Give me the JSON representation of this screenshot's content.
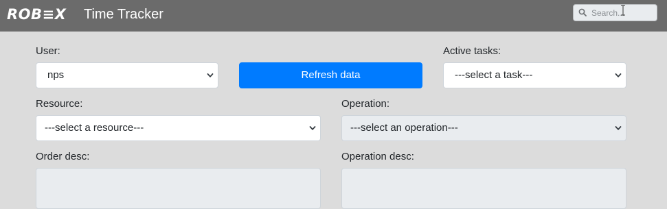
{
  "header": {
    "logo_text": "ROB≡X",
    "title": "Time Tracker",
    "search": {
      "placeholder": "Search..."
    }
  },
  "form": {
    "user": {
      "label": "User:",
      "value": "nps"
    },
    "refresh_button": {
      "label": "Refresh data"
    },
    "active_tasks": {
      "label": "Active tasks:",
      "value": "---select a task---"
    },
    "resource": {
      "label": "Resource:",
      "value": "---select a resource---"
    },
    "operation": {
      "label": "Operation:",
      "value": "---select an operation---"
    },
    "order_desc": {
      "label": "Order desc:",
      "value": ""
    },
    "operation_desc": {
      "label": "Operation desc:",
      "value": ""
    }
  },
  "colors": {
    "navbar": "#6b6b6b",
    "background": "#dcdcdc",
    "primary_button": "#007bff",
    "disabled_field": "#e9ecef"
  },
  "icons": {
    "search": "magnifier-icon",
    "select_arrow": "chevron-down-icon",
    "cursor": "text-cursor-icon"
  }
}
